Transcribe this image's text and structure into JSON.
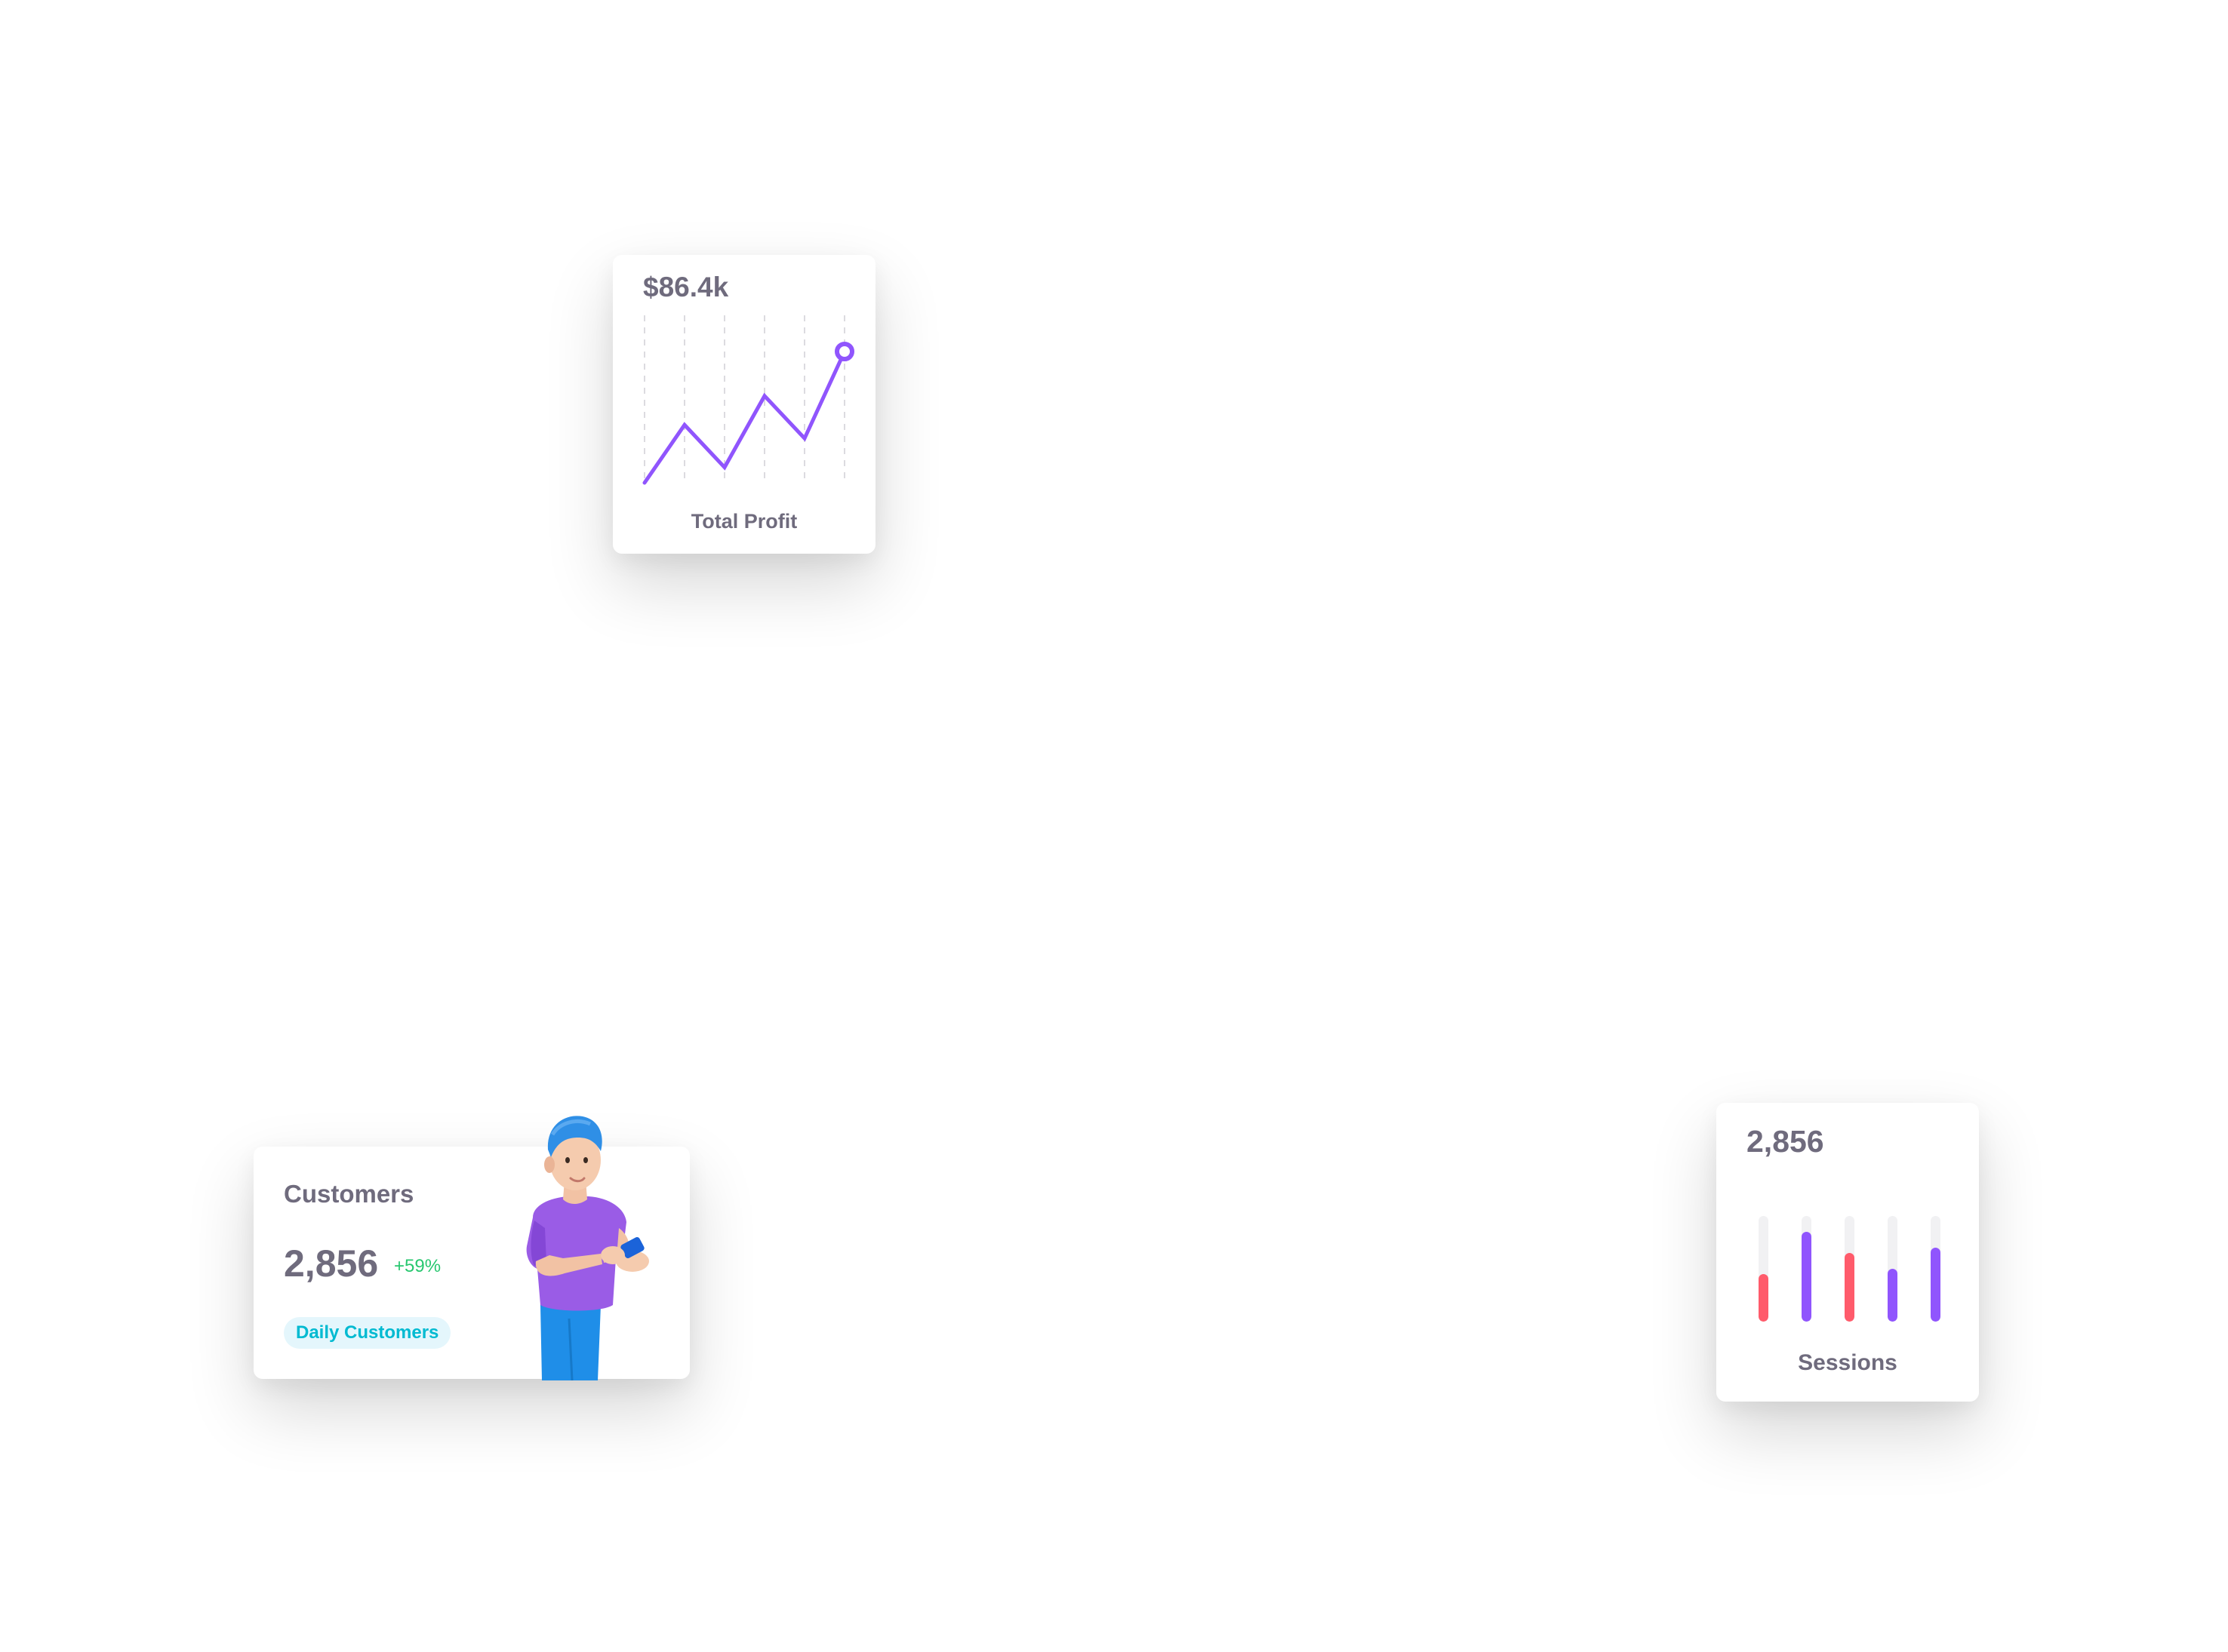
{
  "profit_card": {
    "amount": "$86.4k",
    "caption": "Total Profit",
    "line_color": "#9055fd",
    "chart_data": {
      "type": "line",
      "values": [
        0,
        30,
        8,
        45,
        23,
        68
      ]
    }
  },
  "customers_card": {
    "title": "Customers",
    "count": "2,856",
    "delta": "+59%",
    "badge": "Daily Customers",
    "illustration": "person-with-phone-illustration"
  },
  "sessions_card": {
    "count": "2,856",
    "caption": "Sessions",
    "chart_data": {
      "type": "bar",
      "values": [
        45,
        85,
        65,
        50,
        70
      ],
      "colors": [
        "#ff5b6b",
        "#9055fd",
        "#ff5b6b",
        "#9055fd",
        "#9055fd"
      ],
      "ylim": [
        0,
        100
      ]
    }
  }
}
